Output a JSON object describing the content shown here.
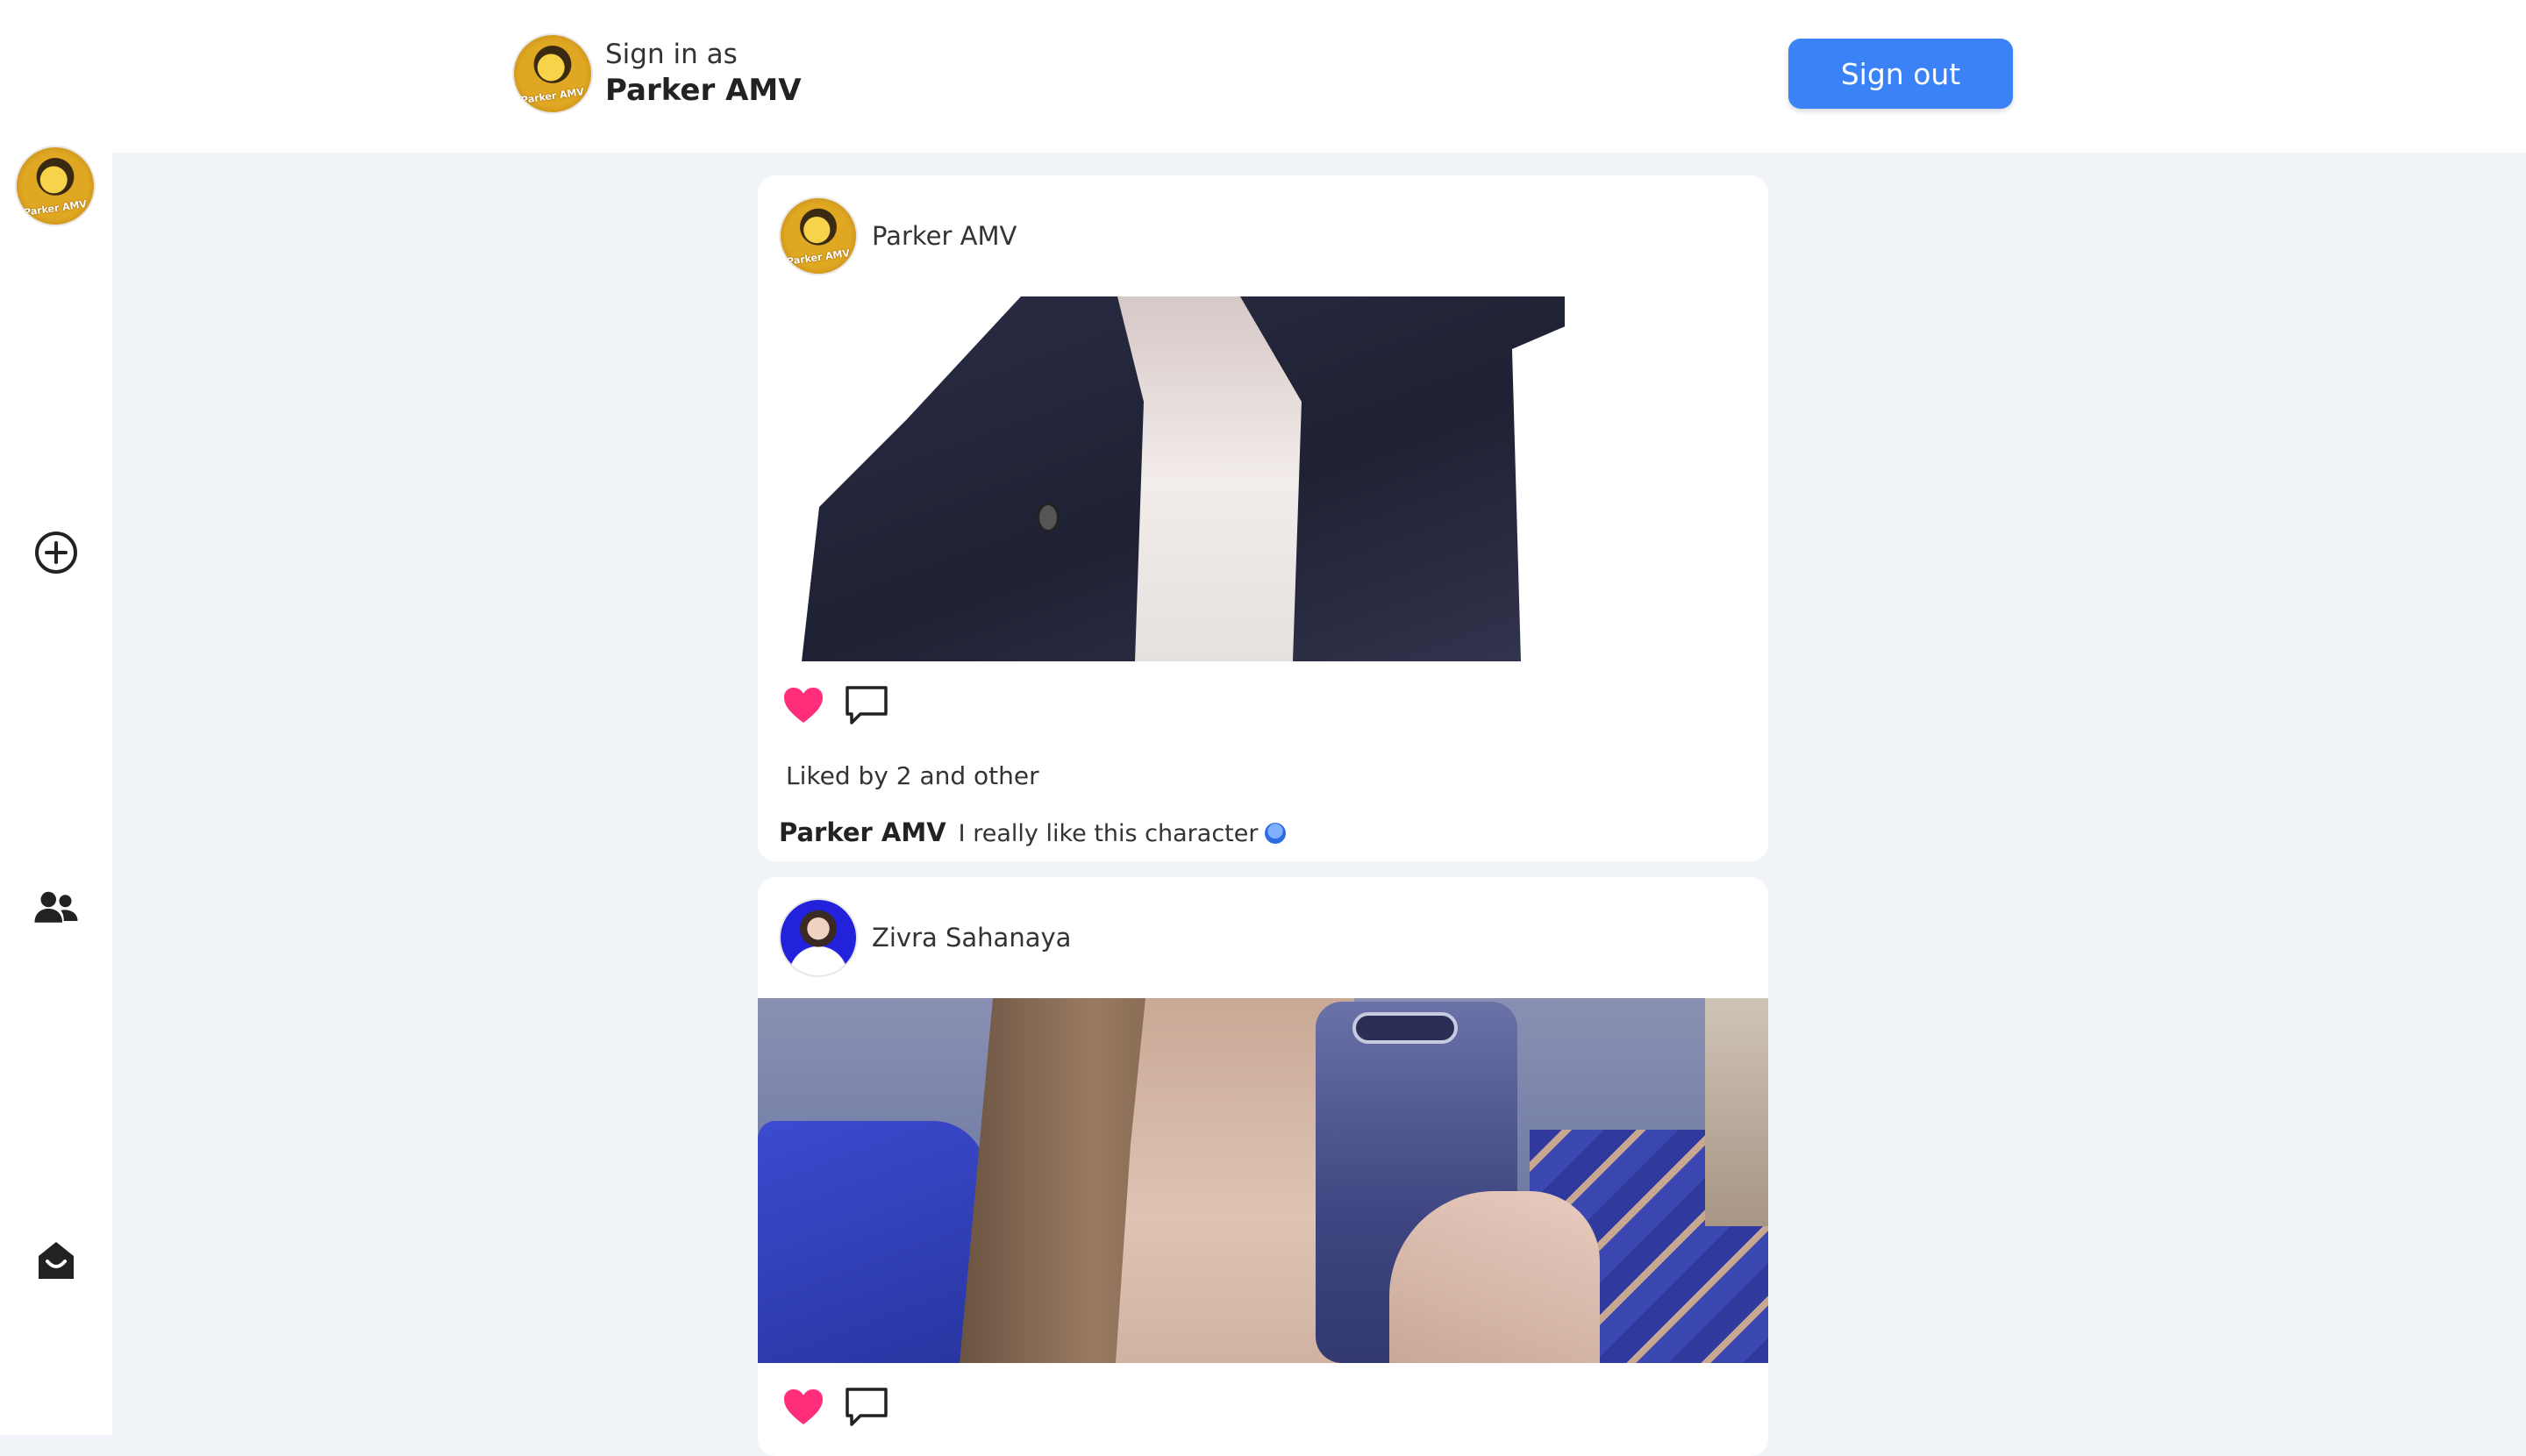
{
  "header": {
    "signin_label": "Sign in as",
    "signin_name": "Parker AMV",
    "signout_label": "Sign out",
    "signout_color": "#3b82f6"
  },
  "sidebar": {
    "items": [
      {
        "icon": "profile-avatar"
      },
      {
        "icon": "plus-circle-icon"
      },
      {
        "icon": "users-icon"
      },
      {
        "icon": "home-icon"
      }
    ]
  },
  "posts": [
    {
      "author": "Parker AMV",
      "likes_text": "Liked by 2 and other",
      "caption_author": "Parker AMV",
      "caption_text": "I really like this character",
      "liked": true,
      "like_color": "#ff2d7a"
    },
    {
      "author": "Zivra Sahanaya",
      "liked": true,
      "like_color": "#ff2d7a"
    }
  ]
}
